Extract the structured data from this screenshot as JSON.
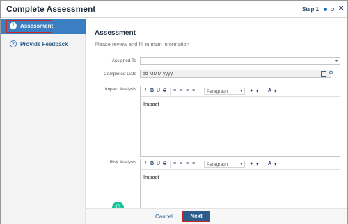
{
  "header": {
    "title": "Complete Assessment",
    "step_label": "Step 1",
    "close_icon": "close-icon"
  },
  "sidebar": {
    "items": [
      {
        "number": "1",
        "label": "Assessment",
        "active": true
      },
      {
        "number": "2",
        "label": "Provide Feedback",
        "active": false
      }
    ]
  },
  "main": {
    "section_title": "Assessment",
    "section_subtitle": "Please review and fill in main information",
    "fields": {
      "assigned_to": {
        "label": "Assigned To",
        "value": ""
      },
      "completed_date": {
        "label": "Completed Date",
        "placeholder": "dd MMM yyyy"
      },
      "impact_analysis": {
        "label": "Impact Analysis",
        "content": "Impact"
      },
      "risk_analysis": {
        "label": "Risk Analysis",
        "content": "Impact"
      }
    },
    "toolbar": {
      "italic": "I",
      "bold": "B",
      "underline": "U",
      "strike": "S",
      "paragraph": "Paragraph",
      "font_color": "A",
      "more": "⋮"
    }
  },
  "footer": {
    "cancel_label": "Cancel",
    "next_label": "Next"
  },
  "colors": {
    "accent": "#3b7fc2",
    "primary_button": "#2e5c8a",
    "highlight_border": "#c62828",
    "grammarly": "#15c39a"
  }
}
